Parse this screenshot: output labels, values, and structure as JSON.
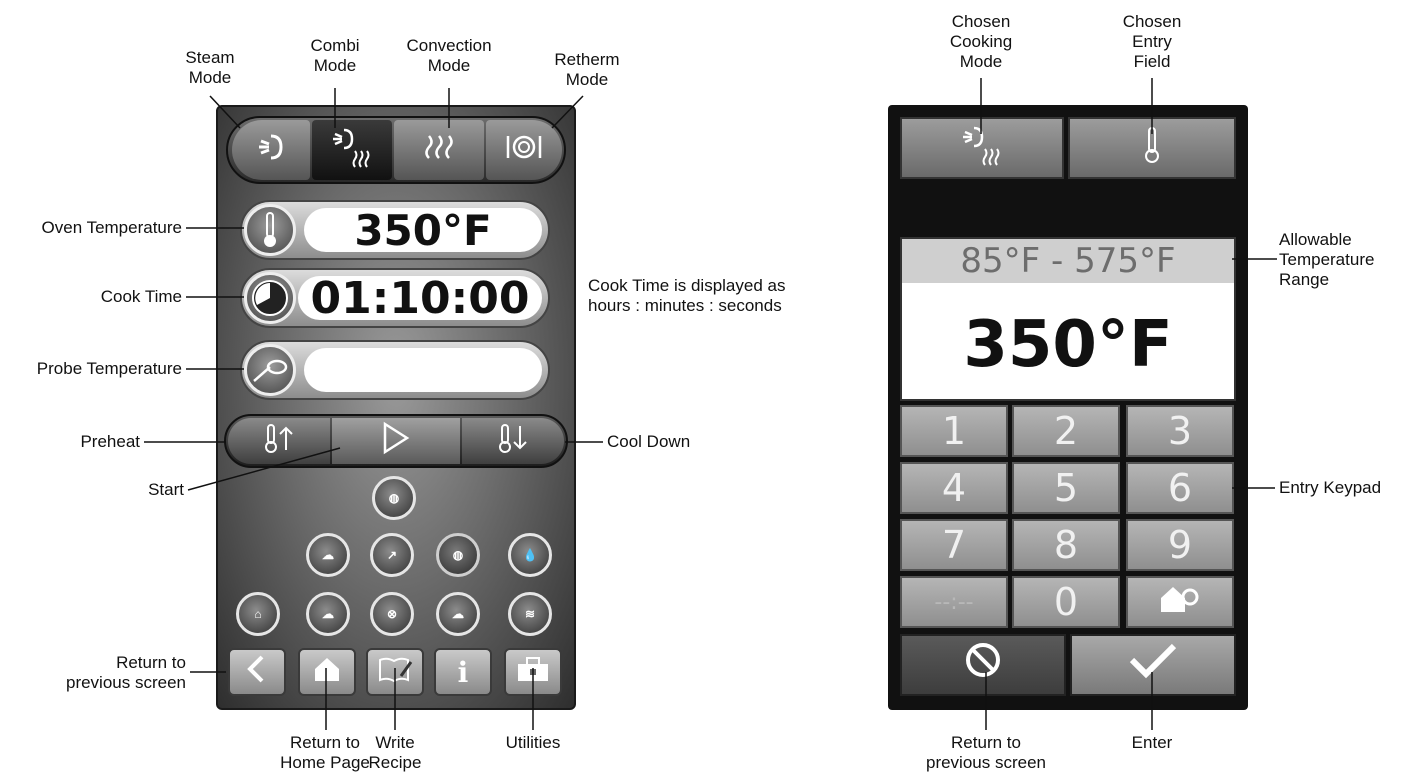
{
  "left_screen": {
    "modes": [
      {
        "name": "steam",
        "icon": "steam-icon",
        "glyph": "≈"
      },
      {
        "name": "combi",
        "icon": "combi-icon",
        "glyph": "≈"
      },
      {
        "name": "convection",
        "icon": "convection-icon",
        "glyph": "⌇"
      },
      {
        "name": "retherm",
        "icon": "retherm-icon",
        "glyph": "◎"
      }
    ],
    "oven_temperature": "350°F",
    "cook_time": "01:10:00",
    "probe_temperature": "",
    "nav_icons": [
      "back-icon",
      "home-icon",
      "recipe-icon",
      "info-icon",
      "toolbox-icon"
    ],
    "info_glyph": "i"
  },
  "right_screen": {
    "range": "85°F - 575°F",
    "value": "350°F",
    "keys": [
      "1",
      "2",
      "3",
      "4",
      "5",
      "6",
      "7",
      "8",
      "9",
      "--:--",
      "0",
      ""
    ]
  },
  "callouts": {
    "steam_mode": "Steam\nMode",
    "combi_mode": "Combi\nMode",
    "convection_mode": "Convection\nMode",
    "retherm_mode": "Retherm\nMode",
    "oven_temperature": "Oven Temperature",
    "cook_time": "Cook Time",
    "probe_temperature": "Probe Temperature",
    "preheat": "Preheat",
    "cool_down": "Cool Down",
    "start": "Start",
    "cook_time_note": "Cook Time is displayed as\nhours : minutes : seconds",
    "return_previous_left": "Return to\nprevious screen",
    "return_home": "Return to\nHome Page",
    "write_recipe": "Write\nRecipe",
    "utilities": "Utilities",
    "chosen_cooking_mode": "Chosen\nCooking\nMode",
    "chosen_entry_field": "Chosen\nEntry\nField",
    "allowable_range": "Allowable\nTemperature\nRange",
    "entry_keypad": "Entry Keypad",
    "return_previous_right": "Return to\nprevious screen",
    "enter": "Enter"
  }
}
